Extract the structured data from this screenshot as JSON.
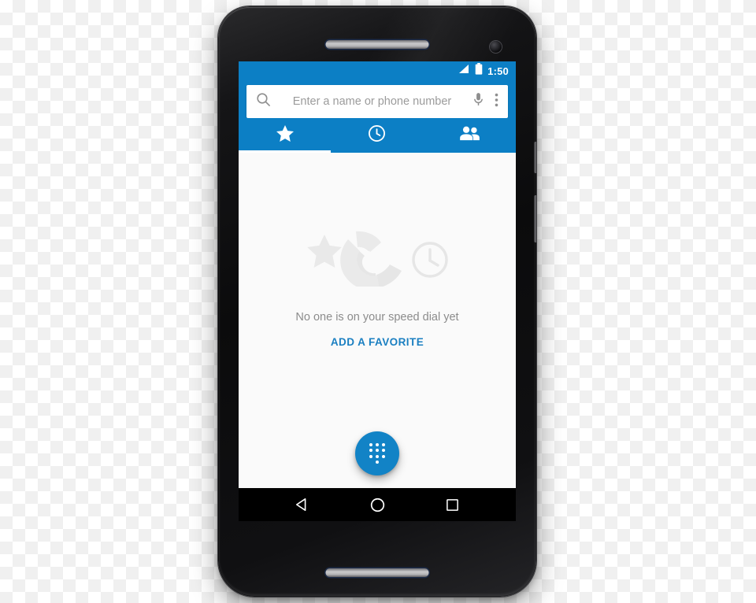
{
  "device": {
    "name": "Motorola Moto X (2nd gen)",
    "earpiece_grille": "speaker-grille",
    "front_camera": "front-camera",
    "side_buttons": [
      "power-button",
      "volume-rocker"
    ]
  },
  "status_bar": {
    "time": "1:50",
    "signal_icon": "signal-triangle-icon",
    "battery_icon": "battery-full-icon",
    "background_color": "#0c7fc5"
  },
  "app_bar": {
    "background_color": "#0c7fc5",
    "search": {
      "placeholder": "Enter a name or phone number",
      "value": "",
      "search_icon": "search-icon",
      "voice_icon": "microphone-icon",
      "overflow_icon": "overflow-menu-icon"
    }
  },
  "tabs": {
    "active_index": 0,
    "indicator_color": "#ffffff",
    "items": [
      {
        "icon": "star-icon",
        "name": "speed-dial",
        "label": "Speed dial"
      },
      {
        "icon": "clock-icon",
        "name": "recents",
        "label": "Recents"
      },
      {
        "icon": "contacts-icon",
        "name": "contacts",
        "label": "Contacts"
      }
    ]
  },
  "content": {
    "background_color": "#fafafa",
    "empty_state": {
      "art_icons": [
        "star-icon",
        "phone-handset-icon",
        "clock-icon"
      ],
      "art_color": "#e8e8e8",
      "message": "No one is on your speed dial yet",
      "action_label": "ADD A FAVORITE",
      "action_color": "#1a7fc1"
    }
  },
  "fab": {
    "name": "dialpad-fab",
    "icon": "dialpad-icon",
    "color": "#1283c6"
  },
  "nav_bar": {
    "background_color": "#000000",
    "buttons": [
      {
        "name": "back",
        "icon": "back-triangle-icon"
      },
      {
        "name": "home",
        "icon": "home-circle-icon"
      },
      {
        "name": "recents",
        "icon": "recents-square-icon"
      }
    ]
  }
}
